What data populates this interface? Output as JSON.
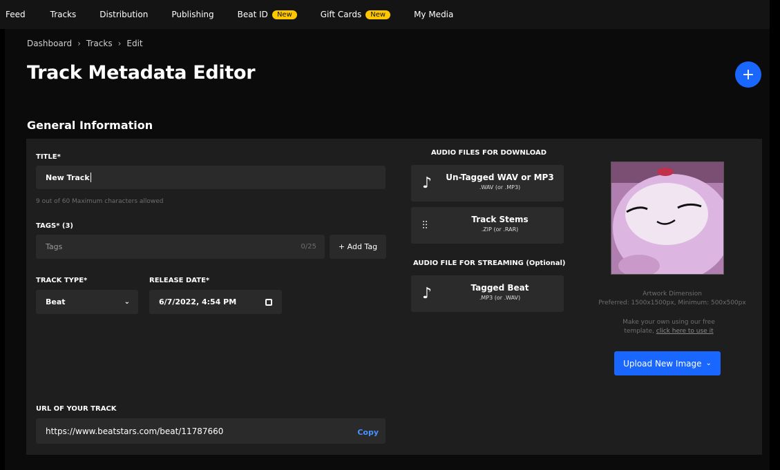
{
  "nav": {
    "items": [
      "Feed",
      "Tracks",
      "Distribution",
      "Publishing",
      "Beat ID",
      "Gift Cards",
      "My Media"
    ],
    "badge_new": "New"
  },
  "breadcrumb": [
    "Dashboard",
    "Tracks",
    "Edit"
  ],
  "page_title": "Track Metadata Editor",
  "add_button": "+",
  "section_title": "General Information",
  "form": {
    "title_label": "TITLE*",
    "title_value": "New Track",
    "title_hint": "9 out of 60 Maximum characters allowed",
    "tags_label": "TAGS* (3)",
    "tags_placeholder": "Tags",
    "tags_count": "0/25",
    "add_tag": "+ Add Tag",
    "track_type_label": "TRACK TYPE*",
    "track_type_value": "Beat",
    "release_date_label": "RELEASE DATE*",
    "release_date_value": "6/7/2022, 4:54 PM",
    "url_label": "URL OF YOUR TRACK",
    "url_value": "https://www.beatstars.com/beat/11787660",
    "copy_label": "Copy"
  },
  "audio": {
    "download_heading": "AUDIO FILES FOR DOWNLOAD",
    "streaming_heading": "AUDIO FILE FOR STREAMING (Optional)",
    "cards": [
      {
        "title": "Un-Tagged WAV or MP3",
        "sub": ".WAV (or .MP3)",
        "icon": "music-note-icon"
      },
      {
        "title": "Track Stems",
        "sub": ".ZIP (or .RAR)",
        "icon": "sliders-icon"
      },
      {
        "title": "Tagged Beat",
        "sub": ".MP3 (or .WAV)",
        "icon": "music-note-icon"
      }
    ]
  },
  "artwork": {
    "dimension_title": "Artwork Dimension",
    "dimension_text": "Preferred: 1500x1500px, Minimum: 500x500px",
    "template_text": "Make your own using our free template,",
    "template_link": "click here to use it",
    "upload_button": "Upload New Image"
  },
  "colors": {
    "accent": "#1967ff",
    "badge": "#ffc700",
    "panel": "#1e1e1e",
    "field": "#2a2a2a"
  }
}
